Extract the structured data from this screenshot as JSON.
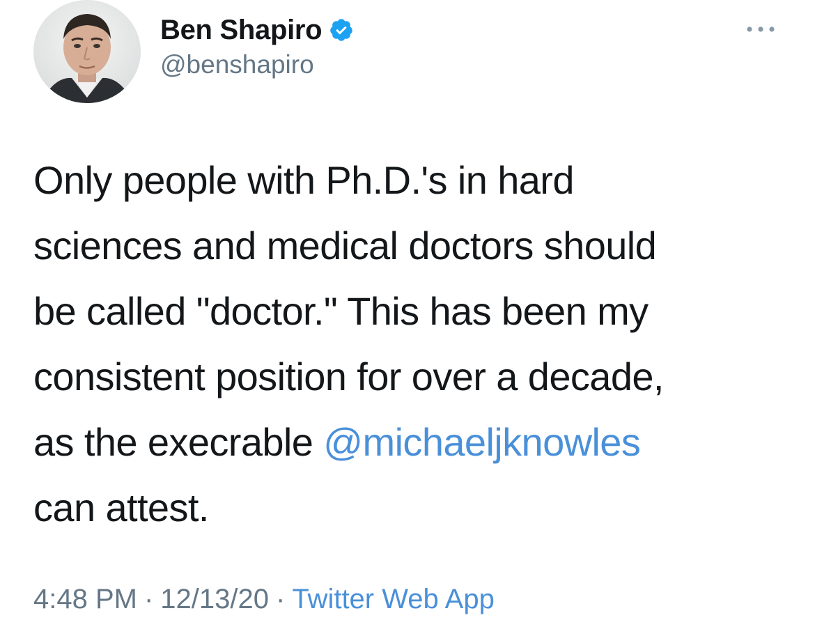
{
  "author": {
    "display_name": "Ben Shapiro",
    "handle": "@benshapiro",
    "verified": true,
    "avatar_icon": "profile-photo-icon",
    "verified_icon": "verified-badge-icon"
  },
  "menu": {
    "icon": "more-options-icon"
  },
  "tweet": {
    "line1": "Only people with Ph.D.'s in hard",
    "line2": "sciences and medical doctors should",
    "line3": "be called \"doctor.\" This has been my",
    "line4": "consistent position for over a decade,",
    "line5_prefix": "as the execrable ",
    "mention": "@michaeljknowles",
    "line6": "can attest."
  },
  "meta": {
    "time": "4:48 PM",
    "separator": "·",
    "date": "12/13/20",
    "source": "Twitter Web App"
  },
  "colors": {
    "text": "#14171a",
    "secondary": "#657786",
    "link": "#4a90d9",
    "verified": "#1da1f2"
  }
}
